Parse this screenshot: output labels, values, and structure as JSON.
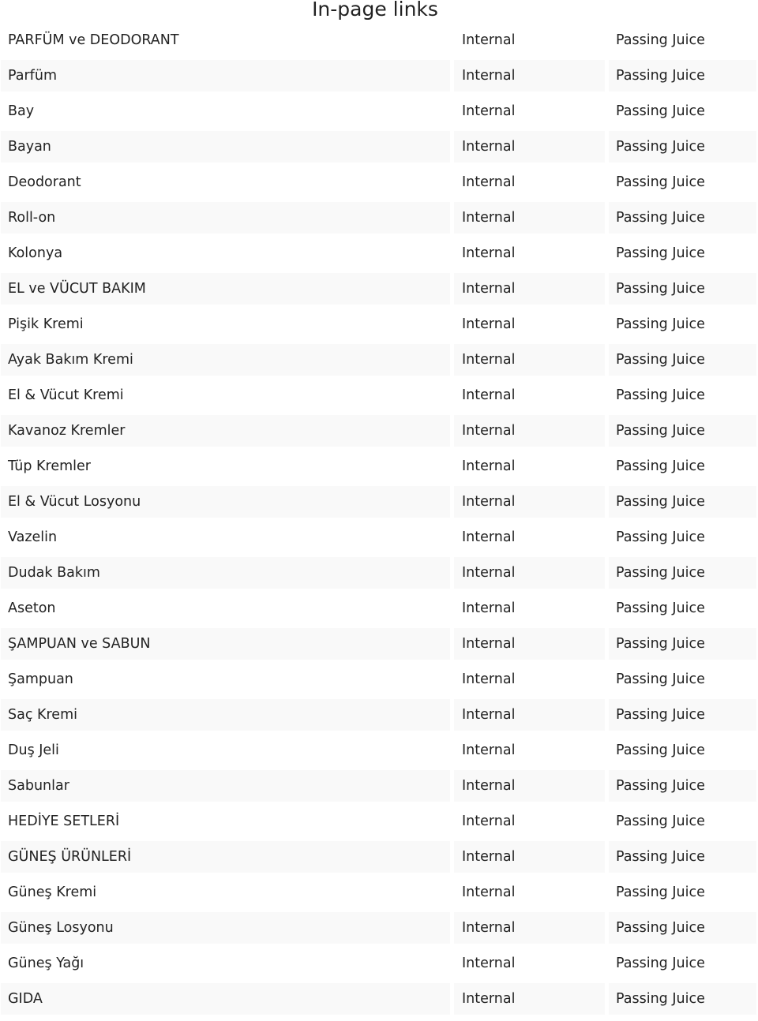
{
  "title": "In-page links",
  "rows": [
    {
      "name": "PARFÜM ve DEODORANT",
      "type": "Internal",
      "juice": "Passing Juice"
    },
    {
      "name": "Parfüm",
      "type": "Internal",
      "juice": "Passing Juice"
    },
    {
      "name": "Bay",
      "type": "Internal",
      "juice": "Passing Juice"
    },
    {
      "name": "Bayan",
      "type": "Internal",
      "juice": "Passing Juice"
    },
    {
      "name": "Deodorant",
      "type": "Internal",
      "juice": "Passing Juice"
    },
    {
      "name": "Roll-on",
      "type": "Internal",
      "juice": "Passing Juice"
    },
    {
      "name": "Kolonya",
      "type": "Internal",
      "juice": "Passing Juice"
    },
    {
      "name": "EL ve VÜCUT BAKIM",
      "type": "Internal",
      "juice": "Passing Juice"
    },
    {
      "name": "Pişik Kremi",
      "type": "Internal",
      "juice": "Passing Juice"
    },
    {
      "name": "Ayak Bakım Kremi",
      "type": "Internal",
      "juice": "Passing Juice"
    },
    {
      "name": "El & Vücut Kremi",
      "type": "Internal",
      "juice": "Passing Juice"
    },
    {
      "name": "Kavanoz Kremler",
      "type": "Internal",
      "juice": "Passing Juice"
    },
    {
      "name": "Tüp Kremler",
      "type": "Internal",
      "juice": "Passing Juice"
    },
    {
      "name": "El & Vücut Losyonu",
      "type": "Internal",
      "juice": "Passing Juice"
    },
    {
      "name": "Vazelin",
      "type": "Internal",
      "juice": "Passing Juice"
    },
    {
      "name": "Dudak Bakım",
      "type": "Internal",
      "juice": "Passing Juice"
    },
    {
      "name": "Aseton",
      "type": "Internal",
      "juice": "Passing Juice"
    },
    {
      "name": "ŞAMPUAN ve SABUN",
      "type": "Internal",
      "juice": "Passing Juice"
    },
    {
      "name": "Şampuan",
      "type": "Internal",
      "juice": "Passing Juice"
    },
    {
      "name": "Saç Kremi",
      "type": "Internal",
      "juice": "Passing Juice"
    },
    {
      "name": "Duş Jeli",
      "type": "Internal",
      "juice": "Passing Juice"
    },
    {
      "name": "Sabunlar",
      "type": "Internal",
      "juice": "Passing Juice"
    },
    {
      "name": "HEDİYE SETLERİ",
      "type": "Internal",
      "juice": "Passing Juice"
    },
    {
      "name": "GÜNEŞ ÜRÜNLERİ",
      "type": "Internal",
      "juice": "Passing Juice"
    },
    {
      "name": "Güneş Kremi",
      "type": "Internal",
      "juice": "Passing Juice"
    },
    {
      "name": "Güneş Losyonu",
      "type": "Internal",
      "juice": "Passing Juice"
    },
    {
      "name": "Güneş Yağı",
      "type": "Internal",
      "juice": "Passing Juice"
    },
    {
      "name": "GIDA",
      "type": "Internal",
      "juice": "Passing Juice"
    }
  ]
}
